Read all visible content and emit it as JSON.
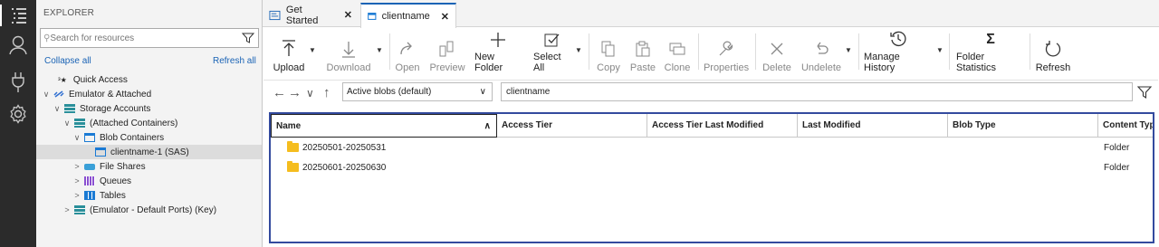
{
  "activity_bar": {
    "items": [
      "explorer-icon",
      "account-icon",
      "plug-icon",
      "settings-icon"
    ]
  },
  "explorer": {
    "title": "EXPLORER",
    "search_placeholder": "Search for resources",
    "collapse_all": "Collapse all",
    "refresh_all": "Refresh all",
    "tree": [
      {
        "label": "Quick Access"
      },
      {
        "label": "Emulator & Attached"
      },
      {
        "label": "Storage Accounts"
      },
      {
        "label": "(Attached Containers)"
      },
      {
        "label": "Blob Containers"
      },
      {
        "label": "clientname-1 (SAS)"
      },
      {
        "label": "File Shares"
      },
      {
        "label": "Queues"
      },
      {
        "label": "Tables"
      },
      {
        "label": "(Emulator - Default Ports) (Key)"
      }
    ]
  },
  "tabs": [
    {
      "label": "Get Started",
      "close": "✕"
    },
    {
      "label": "clientname",
      "close": "✕"
    }
  ],
  "toolbar": {
    "upload": "Upload",
    "download": "Download",
    "open": "Open",
    "preview": "Preview",
    "new_folder": "New Folder",
    "select_all": "Select All",
    "copy": "Copy",
    "paste": "Paste",
    "clone": "Clone",
    "properties": "Properties",
    "delete": "Delete",
    "undelete": "Undelete",
    "manage_history": "Manage History",
    "folder_statistics": "Folder Statistics",
    "refresh": "Refresh"
  },
  "address": {
    "view_select": "Active blobs (default)",
    "path": "clientname"
  },
  "grid": {
    "columns": [
      "Name",
      "Access Tier",
      "Access Tier Last Modified",
      "Last Modified",
      "Blob Type",
      "Content Typ"
    ],
    "rows": [
      {
        "name": "20250501-20250531",
        "content_type": "Folder"
      },
      {
        "name": "20250601-20250630",
        "content_type": "Folder"
      }
    ]
  }
}
